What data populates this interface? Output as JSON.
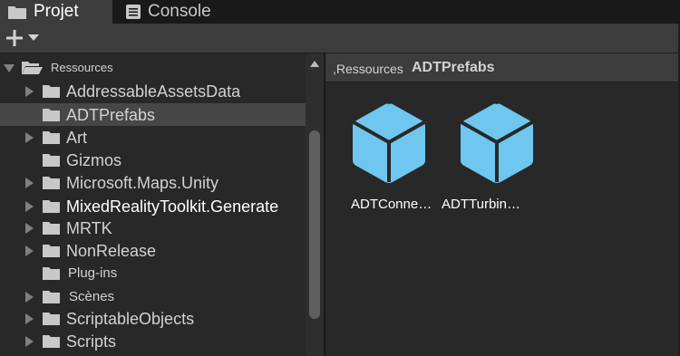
{
  "tabs": {
    "project": "Projet",
    "console": "Console"
  },
  "tree": {
    "root": "Ressources",
    "items": [
      {
        "label": "AddressableAssetsData",
        "has_children": true,
        "selected": false
      },
      {
        "label": "ADTPrefabs",
        "has_children": false,
        "selected": true
      },
      {
        "label": "Art",
        "has_children": true,
        "selected": false
      },
      {
        "label": "Gizmos",
        "has_children": false,
        "selected": false
      },
      {
        "label": "Microsoft.Maps.Unity",
        "has_children": true,
        "selected": false
      },
      {
        "label": "MixedRealityToolkit.Generate",
        "has_children": true,
        "selected": false
      },
      {
        "label": "MRTK",
        "has_children": true,
        "selected": false
      },
      {
        "label": "NonRelease",
        "has_children": true,
        "selected": false
      },
      {
        "label": "Plug-ins",
        "has_children": false,
        "selected": false
      },
      {
        "label": "Scènes",
        "has_children": true,
        "selected": false
      },
      {
        "label": "ScriptableObjects",
        "has_children": true,
        "selected": false
      },
      {
        "label": "Scripts",
        "has_children": true,
        "selected": false
      }
    ]
  },
  "breadcrumb": {
    "parent": ",Ressources",
    "current": "ADTPrefabs"
  },
  "assets": [
    {
      "label": "ADTConne…",
      "icon": "prefab-cube-icon"
    },
    {
      "label": "ADTTurbin…",
      "icon": "prefab-cube-icon"
    }
  ],
  "colors": {
    "prefab": "#6fc6ef",
    "selection": "#474747",
    "panel": "#282828",
    "toolbar": "#3c3c3c"
  }
}
